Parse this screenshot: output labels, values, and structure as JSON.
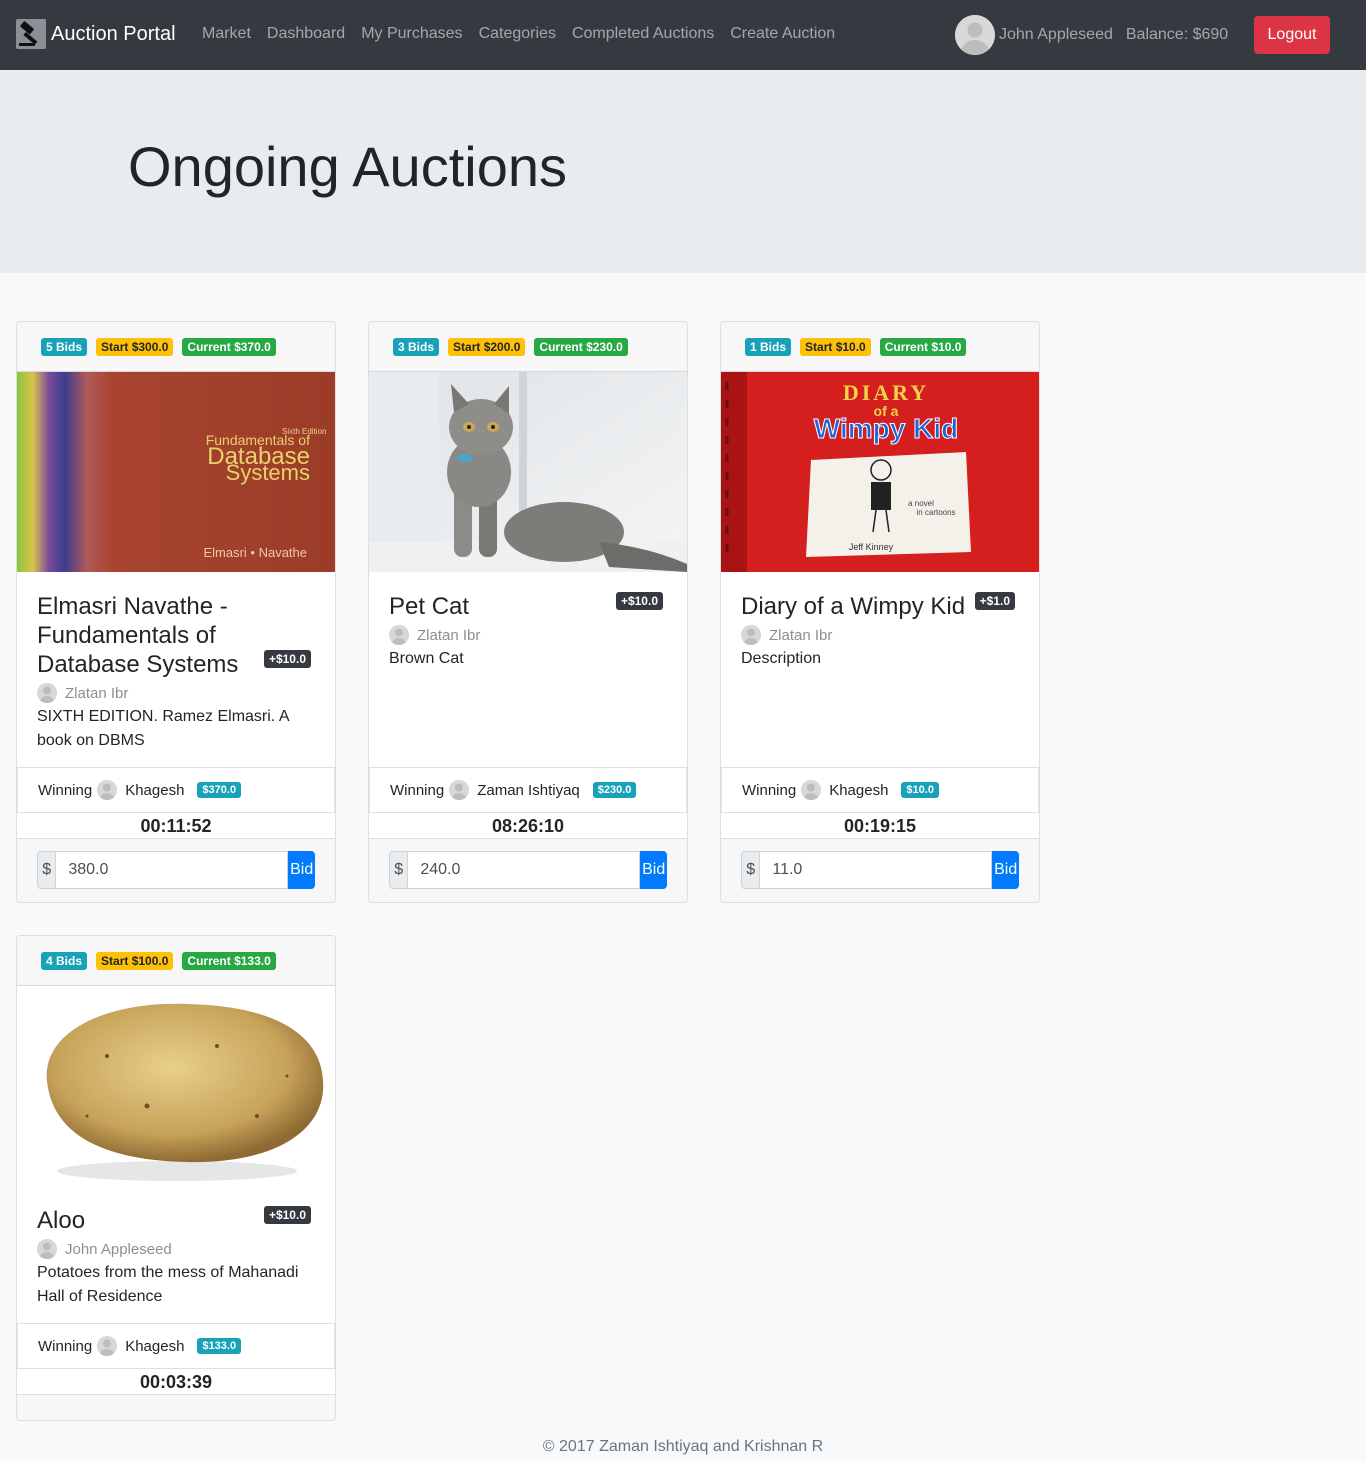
{
  "nav": {
    "brand": "Auction Portal",
    "links": [
      "Market",
      "Dashboard",
      "My Purchases",
      "Categories",
      "Completed Auctions",
      "Create Auction"
    ],
    "user_name": "John Appleseed",
    "balance": "Balance: $690",
    "logout": "Logout"
  },
  "page": {
    "title": "Ongoing Auctions"
  },
  "auctions": [
    {
      "bids": "5 Bids",
      "start": "Start $300.0",
      "current": "Current $370.0",
      "title": "Elmasri Navathe - Fundamentals of Database Systems",
      "increment": "+$10.0",
      "seller": "Zlatan Ibr",
      "description": "SIXTH EDITION. Ramez Elmasri. A book on DBMS",
      "winning_label": "Winning",
      "winner": "Khagesh",
      "winner_amount": "$370.0",
      "timer": "00:11:52",
      "currency": "$",
      "bid_value": "380.0",
      "bid_button": "Bid",
      "image": {
        "cover_edition": "Sixth Edition",
        "cover_title": [
          "Fundamentals of",
          "Database",
          "Systems"
        ],
        "cover_authors": "Elmasri • Navathe"
      }
    },
    {
      "bids": "3 Bids",
      "start": "Start $200.0",
      "current": "Current $230.0",
      "title": "Pet Cat",
      "increment": "+$10.0",
      "seller": "Zlatan Ibr",
      "description": "Brown Cat",
      "winning_label": "Winning",
      "winner": "Zaman Ishtiyaq",
      "winner_amount": "$230.0",
      "timer": "08:26:10",
      "currency": "$",
      "bid_value": "240.0",
      "bid_button": "Bid"
    },
    {
      "bids": "1 Bids",
      "start": "Start $10.0",
      "current": "Current $10.0",
      "title": "Diary of a Wimpy Kid",
      "increment": "+$1.0",
      "seller": "Zlatan Ibr",
      "description": "Description",
      "winning_label": "Winning",
      "winner": "Khagesh",
      "winner_amount": "$10.0",
      "timer": "00:19:15",
      "currency": "$",
      "bid_value": "11.0",
      "bid_button": "Bid",
      "image": {
        "cover_line1": "DIARY",
        "cover_line2": "of a",
        "cover_line3": "Wimpy Kid",
        "cover_note": [
          "a novel",
          "in cartoons"
        ],
        "cover_author": "Jeff Kinney"
      }
    },
    {
      "bids": "4 Bids",
      "start": "Start $100.0",
      "current": "Current $133.0",
      "title": "Aloo",
      "increment": "+$10.0",
      "seller": "John Appleseed",
      "description": "Potatoes from the mess of Mahanadi Hall of Residence",
      "winning_label": "Winning",
      "winner": "Khagesh",
      "winner_amount": "$133.0",
      "timer": "00:03:39"
    }
  ],
  "footer": "© 2017 Zaman Ishtiyaq and Krishnan R",
  "colors": {
    "navbar": "#343a40",
    "danger": "#dc3545",
    "primary": "#007bff",
    "info": "#17a2b8",
    "warning": "#ffc107",
    "success": "#28a745"
  },
  "icons": [
    "gavel-icon",
    "user-avatar-icon"
  ]
}
